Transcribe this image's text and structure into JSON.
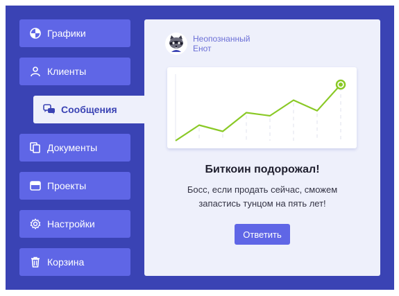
{
  "sidebar": {
    "items": [
      {
        "label": "Графики",
        "icon": "pie-chart-icon",
        "active": false
      },
      {
        "label": "Клиенты",
        "icon": "user-icon",
        "active": false
      },
      {
        "label": "Сообщения",
        "icon": "chat-bubbles-icon",
        "active": true
      },
      {
        "label": "Документы",
        "icon": "documents-icon",
        "active": false
      },
      {
        "label": "Проекты",
        "icon": "folder-icon",
        "active": false
      },
      {
        "label": "Настройки",
        "icon": "gear-icon",
        "active": false
      },
      {
        "label": "Корзина",
        "icon": "trash-icon",
        "active": false
      }
    ]
  },
  "message": {
    "sender_name": "Неопознанный Енот",
    "avatar_icon": "raccoon-avatar",
    "headline": "Биткоин подорожал!",
    "body": "Босс, если продать сейчас, сможем запастись тунцом на пять лет!",
    "reply_label": "Ответить"
  },
  "chart_data": {
    "type": "line",
    "x": [
      0,
      1,
      2,
      3,
      4,
      5,
      6,
      7
    ],
    "series": [
      {
        "values": [
          0,
          25,
          15,
          45,
          40,
          65,
          48,
          90
        ]
      }
    ],
    "ylim": [
      0,
      100
    ],
    "grid": "dashed vertical",
    "line_color": "#8ac926",
    "highlight_last_point": true
  },
  "colors": {
    "background": "#3a43b4",
    "button": "#5f66e6",
    "panel": "#eef0fb",
    "accent_green": "#8ac926"
  }
}
